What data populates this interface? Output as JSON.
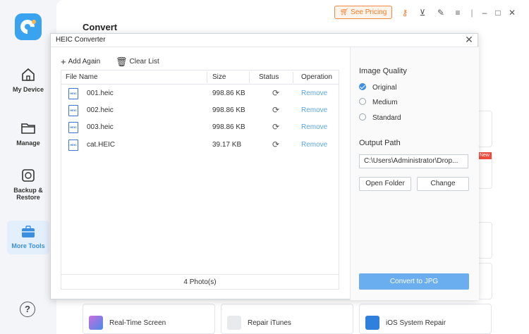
{
  "sidebar": {
    "items": [
      {
        "label": "My Device"
      },
      {
        "label": "Manage"
      },
      {
        "label_line1": "Backup &",
        "label_line2": "Restore"
      },
      {
        "label": "More Tools"
      }
    ],
    "help": "?"
  },
  "main": {
    "title": "Convert"
  },
  "topbar": {
    "pricing": "See Pricing"
  },
  "bg": {
    "new_badge": "New"
  },
  "tools": [
    {
      "label": "Real-Time Screen"
    },
    {
      "label": "Repair iTunes"
    },
    {
      "label": "iOS System Repair"
    }
  ],
  "dialog": {
    "title": "HEIC Converter",
    "add_again": "Add Again",
    "clear_list": "Clear List",
    "columns": [
      "File Name",
      "Size",
      "Status",
      "Operation"
    ],
    "files": [
      {
        "name": "001.heic",
        "size": "998.86 KB",
        "op": "Remove"
      },
      {
        "name": "002.heic",
        "size": "998.86 KB",
        "op": "Remove"
      },
      {
        "name": "003.heic",
        "size": "998.86 KB",
        "op": "Remove"
      },
      {
        "name": "cat.HEIC",
        "size": "39.17 KB",
        "op": "Remove"
      }
    ],
    "footer": "4 Photo(s)",
    "image_quality_label": "Image Quality",
    "quality_options": [
      "Original",
      "Medium",
      "Standard"
    ],
    "selected_quality": "Original",
    "output_path_label": "Output Path",
    "output_path": "C:\\Users\\Administrator\\Drop...",
    "open_folder": "Open Folder",
    "change": "Change",
    "convert": "Convert to JPG"
  },
  "colors": {
    "accent": "#3d8ee6",
    "pricing": "#f07a25",
    "remove": "#5aa6e6"
  }
}
